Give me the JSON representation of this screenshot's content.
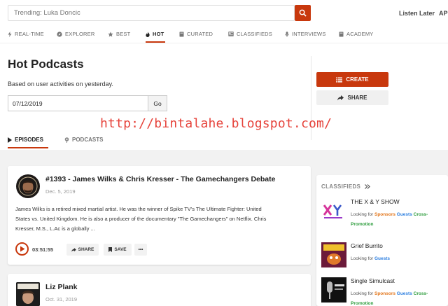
{
  "search": {
    "placeholder": "Trending: Luka Doncic"
  },
  "top_links": {
    "listen_later": "Listen Later",
    "api": "AP"
  },
  "nav": {
    "items": [
      {
        "label": "REAL-TIME",
        "icon": "bolt-icon"
      },
      {
        "label": "EXPLORER",
        "icon": "compass-icon"
      },
      {
        "label": "BEST",
        "icon": "star-icon"
      },
      {
        "label": "HOT",
        "icon": "flame-icon"
      },
      {
        "label": "CURATED",
        "icon": "book-icon"
      },
      {
        "label": "CLASSIFIEDS",
        "icon": "newspaper-icon"
      },
      {
        "label": "INTERVIEWS",
        "icon": "microphone-icon"
      },
      {
        "label": "ACADEMY",
        "icon": "book-icon"
      }
    ],
    "active": "HOT"
  },
  "header": {
    "title": "Hot Podcasts",
    "subtitle": "Based on user activities on yesterday.",
    "date_value": "07/12/2019",
    "go_label": "Go",
    "create_label": "CREATE",
    "share_label": "SHARE"
  },
  "watermark": "http://bintalahe.blogspot.com/",
  "subtabs": {
    "episodes": "EPISODES",
    "podcasts": "PODCASTS"
  },
  "episodes": [
    {
      "title": "#1393 - James Wilks & Chris Kresser - The Gamechangers Debate",
      "date": "Dec. 5, 2019",
      "desc_line1": "James Wilks is a retired mixed martial artist. He was the winner of Spike TV's The Ultimate Fighter: United",
      "desc_line2": "States vs. United Kingdom. He is also a producer of the documentary \"The Gamechangers\" on Netflix. Chris",
      "desc_line3": "Kresser, M.S., L.Ac is a globally ...",
      "duration": "03:51:55",
      "share_label": "SHARE",
      "save_label": "SAVE",
      "more_label": "•••"
    },
    {
      "title": "Liz Plank",
      "date": "Oct. 31, 2019"
    }
  ],
  "classifieds": {
    "heading": "CLASSIFIEDS",
    "looking_for": "Looking for",
    "items": [
      {
        "title": "THE X & Y SHOW",
        "tags": [
          "Sponsors",
          "Guests",
          "Cross-Promotion"
        ]
      },
      {
        "title": "Grief Burrito",
        "tags": [
          "Guests"
        ]
      },
      {
        "title": "Single Simulcast",
        "tags": [
          "Sponsors",
          "Guests",
          "Cross-Promotion"
        ]
      }
    ]
  },
  "colors": {
    "accent": "#c8380d",
    "sponsors": "#e2751a",
    "guests": "#2d7fe0",
    "cross": "#2a9b3a"
  }
}
